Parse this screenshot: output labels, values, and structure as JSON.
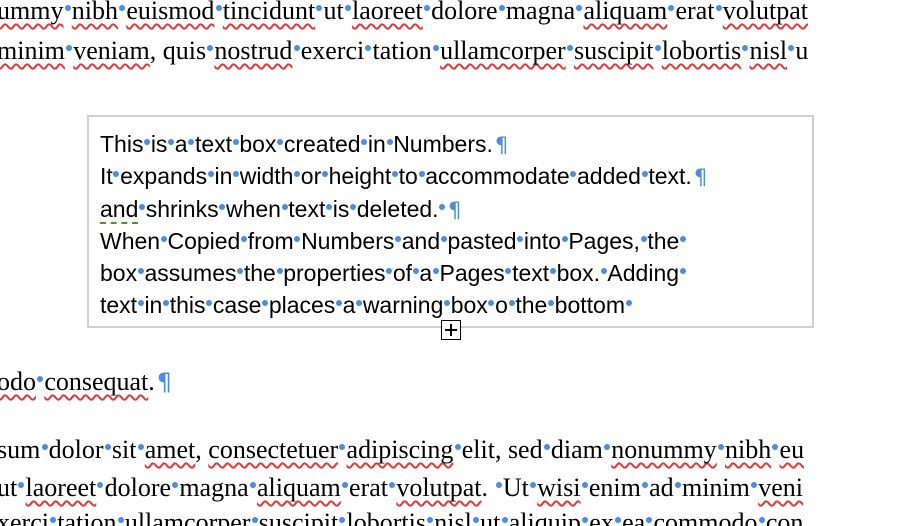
{
  "body": {
    "lines": [
      [
        {
          "t": "ummy",
          "sq": true
        },
        {
          "t": " "
        },
        {
          "t": "nibh",
          "sq": true
        },
        {
          "t": " "
        },
        {
          "t": "euismod",
          "sq": true
        },
        {
          "t": " "
        },
        {
          "t": "tincidunt",
          "sq": true
        },
        {
          "t": " "
        },
        {
          "t": "ut"
        },
        {
          "t": " "
        },
        {
          "t": "laoreet",
          "sq": true
        },
        {
          "t": " "
        },
        {
          "t": "dolore"
        },
        {
          "t": " "
        },
        {
          "t": "magna"
        },
        {
          "t": " "
        },
        {
          "t": "aliquam",
          "sq": true
        },
        {
          "t": " "
        },
        {
          "t": "erat"
        },
        {
          "t": " "
        },
        {
          "t": "volutpat",
          "sq": true
        }
      ],
      [
        {
          "t": "minim",
          "sq": true
        },
        {
          "t": " "
        },
        {
          "t": "veniam",
          "sq": true
        },
        {
          "t": ", "
        },
        {
          "t": "quis"
        },
        {
          "t": " "
        },
        {
          "t": "nostrud",
          "sq": true
        },
        {
          "t": " "
        },
        {
          "t": "exerci"
        },
        {
          "t": " "
        },
        {
          "t": "tation"
        },
        {
          "t": " "
        },
        {
          "t": "ullamcorper",
          "sq": true
        },
        {
          "t": " "
        },
        {
          "t": "suscipit",
          "sq": true
        },
        {
          "t": " "
        },
        {
          "t": "lobortis",
          "sq": true
        },
        {
          "t": " "
        },
        {
          "t": "nisl",
          "sq": true
        },
        {
          "t": " "
        },
        {
          "t": "u"
        }
      ],
      [
        {
          "t": "odo",
          "sq": true
        },
        {
          "t": " "
        },
        {
          "t": "consequat",
          "sq": true
        },
        {
          "t": "."
        },
        {
          "t": "¶",
          "pil": true
        }
      ],
      [
        {
          "t": "sum"
        },
        {
          "t": " "
        },
        {
          "t": "dolor"
        },
        {
          "t": " "
        },
        {
          "t": "sit"
        },
        {
          "t": " "
        },
        {
          "t": "amet",
          "sq": true
        },
        {
          "t": ", "
        },
        {
          "t": "consectetuer",
          "sq": true
        },
        {
          "t": " "
        },
        {
          "t": "adipiscing",
          "sq": true
        },
        {
          "t": " "
        },
        {
          "t": "elit"
        },
        {
          "t": ", "
        },
        {
          "t": "sed"
        },
        {
          "t": " "
        },
        {
          "t": "diam"
        },
        {
          "t": " "
        },
        {
          "t": "nonummy",
          "sq": true
        },
        {
          "t": " "
        },
        {
          "t": "nibh",
          "sq": true
        },
        {
          "t": " "
        },
        {
          "t": "eu",
          "sq": true
        }
      ],
      [
        {
          "t": "ut"
        },
        {
          "t": " "
        },
        {
          "t": "laoreet",
          "sq": true
        },
        {
          "t": " "
        },
        {
          "t": "dolore"
        },
        {
          "t": " "
        },
        {
          "t": "magna"
        },
        {
          "t": " "
        },
        {
          "t": "aliquam",
          "sq": true
        },
        {
          "t": " "
        },
        {
          "t": "erat"
        },
        {
          "t": " "
        },
        {
          "t": "volutpat",
          "sq": true
        },
        {
          "t": ". "
        },
        {
          "t": " "
        },
        {
          "t": "Ut"
        },
        {
          "t": " "
        },
        {
          "t": "wisi",
          "sq": true
        },
        {
          "t": " "
        },
        {
          "t": "enim"
        },
        {
          "t": " "
        },
        {
          "t": "ad"
        },
        {
          "t": " "
        },
        {
          "t": "minim"
        },
        {
          "t": " "
        },
        {
          "t": "veni",
          "sq": true
        }
      ],
      [
        {
          "t": "xerci"
        },
        {
          "t": " "
        },
        {
          "t": "tation"
        },
        {
          "t": " "
        },
        {
          "t": "ullamcorper"
        },
        {
          "t": " "
        },
        {
          "t": "suscipit"
        },
        {
          "t": " "
        },
        {
          "t": "lobortis"
        },
        {
          "t": " "
        },
        {
          "t": "nisl"
        },
        {
          "t": " "
        },
        {
          "t": "ut"
        },
        {
          "t": " "
        },
        {
          "t": "aliquip"
        },
        {
          "t": " "
        },
        {
          "t": "ex"
        },
        {
          "t": " "
        },
        {
          "t": "ea"
        },
        {
          "t": " "
        },
        {
          "t": "commodo"
        },
        {
          "t": " "
        },
        {
          "t": "con"
        }
      ]
    ]
  },
  "text_box": {
    "lines": [
      [
        {
          "t": "This"
        },
        {
          "t": " "
        },
        {
          "t": "is"
        },
        {
          "t": " "
        },
        {
          "t": "a"
        },
        {
          "t": " "
        },
        {
          "t": "text"
        },
        {
          "t": " "
        },
        {
          "t": "box"
        },
        {
          "t": " "
        },
        {
          "t": "created"
        },
        {
          "t": " "
        },
        {
          "t": "in"
        },
        {
          "t": " "
        },
        {
          "t": "Numbers."
        },
        {
          "t": "¶",
          "pil": true
        }
      ],
      [
        {
          "t": "It"
        },
        {
          "t": " "
        },
        {
          "t": "expands"
        },
        {
          "t": " "
        },
        {
          "t": "in"
        },
        {
          "t": " "
        },
        {
          "t": "width"
        },
        {
          "t": " "
        },
        {
          "t": "or"
        },
        {
          "t": " "
        },
        {
          "t": "height"
        },
        {
          "t": " "
        },
        {
          "t": "to"
        },
        {
          "t": " "
        },
        {
          "t": "accommodate"
        },
        {
          "t": " "
        },
        {
          "t": "added"
        },
        {
          "t": " "
        },
        {
          "t": "text."
        },
        {
          "t": "¶",
          "pil": true
        }
      ],
      [
        {
          "t": "and",
          "gq": true
        },
        {
          "t": " "
        },
        {
          "t": "shrinks"
        },
        {
          "t": " "
        },
        {
          "t": "when"
        },
        {
          "t": " "
        },
        {
          "t": "text"
        },
        {
          "t": " "
        },
        {
          "t": "is"
        },
        {
          "t": " "
        },
        {
          "t": "deleted."
        },
        {
          "t": " "
        },
        {
          "t": "¶",
          "pil": true
        }
      ],
      [
        {
          "t": "When"
        },
        {
          "t": " "
        },
        {
          "t": "Copied"
        },
        {
          "t": " "
        },
        {
          "t": "from"
        },
        {
          "t": " "
        },
        {
          "t": "Numbers"
        },
        {
          "t": " "
        },
        {
          "t": "and"
        },
        {
          "t": " "
        },
        {
          "t": "pasted"
        },
        {
          "t": " "
        },
        {
          "t": "into"
        },
        {
          "t": " "
        },
        {
          "t": "Pages,"
        },
        {
          "t": " "
        },
        {
          "t": "the"
        },
        {
          "t": " "
        }
      ],
      [
        {
          "t": "box"
        },
        {
          "t": " "
        },
        {
          "t": "assumes"
        },
        {
          "t": " "
        },
        {
          "t": "the"
        },
        {
          "t": " "
        },
        {
          "t": "properties"
        },
        {
          "t": " "
        },
        {
          "t": "of"
        },
        {
          "t": " "
        },
        {
          "t": "a"
        },
        {
          "t": " "
        },
        {
          "t": "Pages"
        },
        {
          "t": " "
        },
        {
          "t": "text"
        },
        {
          "t": " "
        },
        {
          "t": "box."
        },
        {
          "t": " "
        },
        {
          "t": "Adding"
        },
        {
          "t": " "
        }
      ],
      [
        {
          "t": "text"
        },
        {
          "t": " "
        },
        {
          "t": "in"
        },
        {
          "t": " "
        },
        {
          "t": "this"
        },
        {
          "t": " "
        },
        {
          "t": "case"
        },
        {
          "t": " "
        },
        {
          "t": "places"
        },
        {
          "t": " "
        },
        {
          "t": "a"
        },
        {
          "t": " "
        },
        {
          "t": "warning"
        },
        {
          "t": " "
        },
        {
          "t": "box"
        },
        {
          "t": " "
        },
        {
          "t": "o"
        },
        {
          "t": " "
        },
        {
          "t": "the"
        },
        {
          "t": " "
        },
        {
          "t": "bottom"
        },
        {
          "t": " "
        }
      ]
    ]
  },
  "overflow_handle": {
    "icon": "plus-box-icon"
  },
  "colors": {
    "invisible_marks": "#4a8fdd",
    "spelling_underline": "#e23a3a",
    "grammar_underline": "#4c9a2a",
    "text_box_border": "#cfcfcf"
  }
}
